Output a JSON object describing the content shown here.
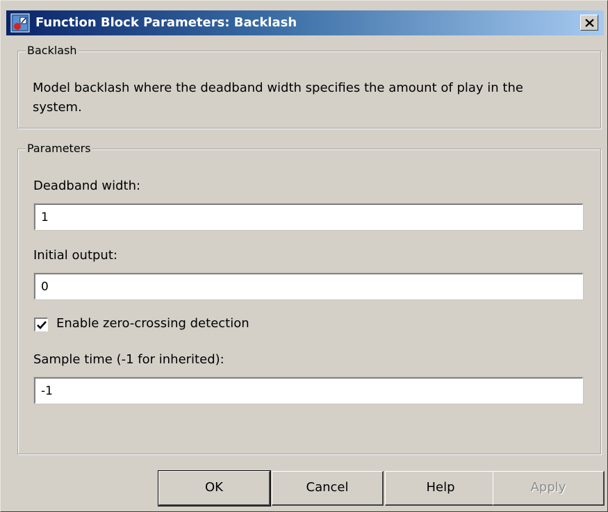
{
  "window": {
    "title": "Function Block Parameters: Backlash",
    "close_icon": "close-icon",
    "app_icon": "simulink-block-icon"
  },
  "description_group": {
    "legend": "Backlash",
    "text": "Model backlash where the deadband width specifies the amount of play in the system."
  },
  "parameters_group": {
    "legend": "Parameters",
    "deadband_width": {
      "label": "Deadband width:",
      "value": "1"
    },
    "initial_output": {
      "label": "Initial output:",
      "value": "0"
    },
    "zero_crossing": {
      "label": "Enable zero-crossing detection",
      "checked": true
    },
    "sample_time": {
      "label": "Sample time (-1 for inherited):",
      "value": "-1"
    }
  },
  "buttons": {
    "ok": "OK",
    "cancel": "Cancel",
    "help": "Help",
    "apply": "Apply"
  },
  "colors": {
    "title_gradient_start": "#0a246a",
    "title_gradient_end": "#a6caf0",
    "dialog_face": "#d4d0c8"
  }
}
